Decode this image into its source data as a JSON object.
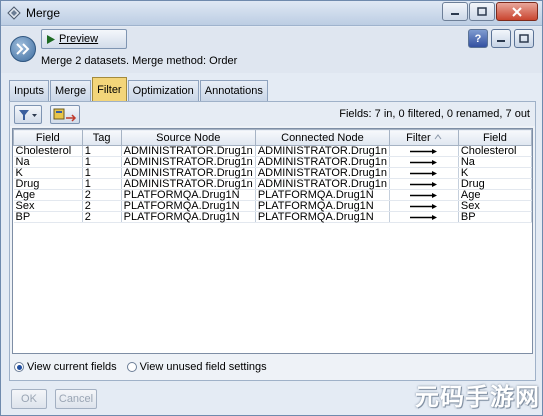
{
  "window": {
    "title": "Merge",
    "minimize_icon": "minimize-icon",
    "maximize_icon": "maximize-icon",
    "close_icon": "close-icon"
  },
  "header": {
    "preview_label": "Preview",
    "description": "Merge 2 datasets. Merge method: Order"
  },
  "tabs": [
    {
      "label": "Inputs",
      "active": false
    },
    {
      "label": "Merge",
      "active": false
    },
    {
      "label": "Filter",
      "active": true
    },
    {
      "label": "Optimization",
      "active": false
    },
    {
      "label": "Annotations",
      "active": false
    }
  ],
  "filter": {
    "status": "Fields: 7 in, 0 filtered, 0 renamed, 7 out",
    "columns": [
      "Field",
      "Tag",
      "Source Node",
      "Connected Node",
      "Filter",
      "Field"
    ],
    "rows": [
      [
        "Cholesterol",
        "1",
        "ADMINISTRATOR.Drug1n",
        "ADMINISTRATOR.Drug1n",
        "Cholesterol"
      ],
      [
        "Na",
        "1",
        "ADMINISTRATOR.Drug1n",
        "ADMINISTRATOR.Drug1n",
        "Na"
      ],
      [
        "K",
        "1",
        "ADMINISTRATOR.Drug1n",
        "ADMINISTRATOR.Drug1n",
        "K"
      ],
      [
        "Drug",
        "1",
        "ADMINISTRATOR.Drug1n",
        "ADMINISTRATOR.Drug1n",
        "Drug"
      ],
      [
        "Age",
        "2",
        "PLATFORMQA.Drug1N",
        "PLATFORMQA.Drug1N",
        "Age"
      ],
      [
        "Sex",
        "2",
        "PLATFORMQA.Drug1N",
        "PLATFORMQA.Drug1N",
        "Sex"
      ],
      [
        "BP",
        "2",
        "PLATFORMQA.Drug1N",
        "PLATFORMQA.Drug1N",
        "BP"
      ]
    ],
    "radio_current": "View current fields",
    "radio_unused": "View unused field settings",
    "selected_radio": "current"
  },
  "footer": {
    "ok_label": "OK",
    "cancel_label": "Cancel"
  },
  "watermark": "元码手游网",
  "colors": {
    "active_tab": "#f3d57a",
    "close_button": "#c9452f",
    "help_button": "#3350a0"
  }
}
